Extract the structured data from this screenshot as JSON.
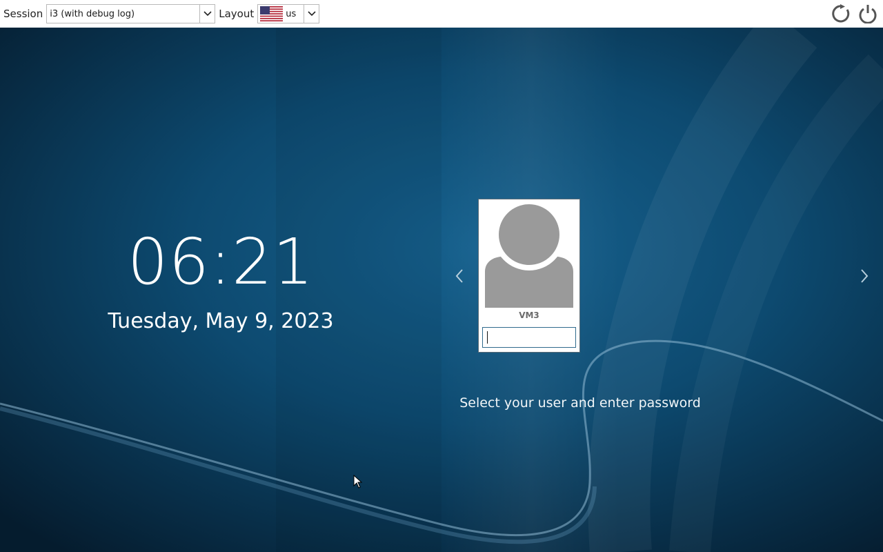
{
  "topbar": {
    "session_label": "Session",
    "session_value": "i3 (with debug log)",
    "layout_label": "Layout",
    "layout_value": "us",
    "layout_flag_icon": "us-flag-icon",
    "reboot_icon": "restart-icon",
    "power_icon": "power-icon"
  },
  "clock": {
    "time": "06:21",
    "date": "Tuesday, May 9, 2023"
  },
  "login": {
    "username": "VM3",
    "password_value": "",
    "hint": "Select your user and enter password"
  },
  "colors": {
    "background_dark": "#06233a",
    "background_mid": "#0e4f78",
    "input_border": "#2f6a8c",
    "avatar_gray": "#9a9a9a"
  }
}
